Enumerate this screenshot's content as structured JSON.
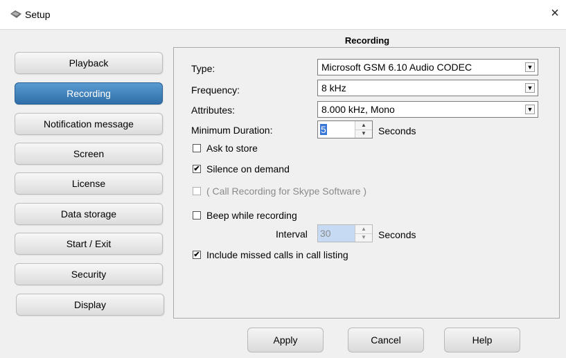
{
  "window": {
    "title": "Setup",
    "close_glyph": "×",
    "icon": "setup-app-icon"
  },
  "sidebar": {
    "items": [
      {
        "label": "Playback"
      },
      {
        "label": "Recording",
        "active": true
      },
      {
        "label": "Notification message"
      },
      {
        "label": "Screen"
      },
      {
        "label": "License"
      },
      {
        "label": "Data storage"
      },
      {
        "label": "Start / Exit"
      },
      {
        "label": "Security"
      },
      {
        "label": "Display"
      }
    ]
  },
  "section": {
    "title": "Recording"
  },
  "form": {
    "type": {
      "label": "Type:",
      "value": "Microsoft GSM 6.10 Audio CODEC"
    },
    "frequency": {
      "label": "Frequency:",
      "value": "8 kHz"
    },
    "attributes": {
      "label": "Attributes:",
      "value": "8.000 kHz, Mono"
    },
    "min_duration": {
      "label": "Minimum Duration:",
      "value": "5",
      "unit": "Seconds"
    },
    "ask_to_store": {
      "label": "Ask to store",
      "checked": false
    },
    "silence_on_demand": {
      "label": "Silence on demand",
      "checked": true
    },
    "call_recording_skype": {
      "label": "( Call Recording for Skype Software )",
      "checked": false,
      "disabled": true
    },
    "beep_while_recording": {
      "label": "Beep while recording",
      "checked": false
    },
    "interval": {
      "label": "Interval",
      "value": "30",
      "unit": "Seconds",
      "disabled": true
    },
    "include_missed_calls": {
      "label": "Include missed calls in call listing",
      "checked": true
    }
  },
  "footer": {
    "apply_label": "Apply",
    "cancel_label": "Cancel",
    "help_label": "Help"
  },
  "glyphs": {
    "check": "✔",
    "dropdown": "▼",
    "spin_up": "▲",
    "spin_down": "▼"
  },
  "colors": {
    "active_tab": "#3f7fbb",
    "interval_highlight": "#c6dbf3",
    "duration_highlight": "#3a78d8"
  }
}
